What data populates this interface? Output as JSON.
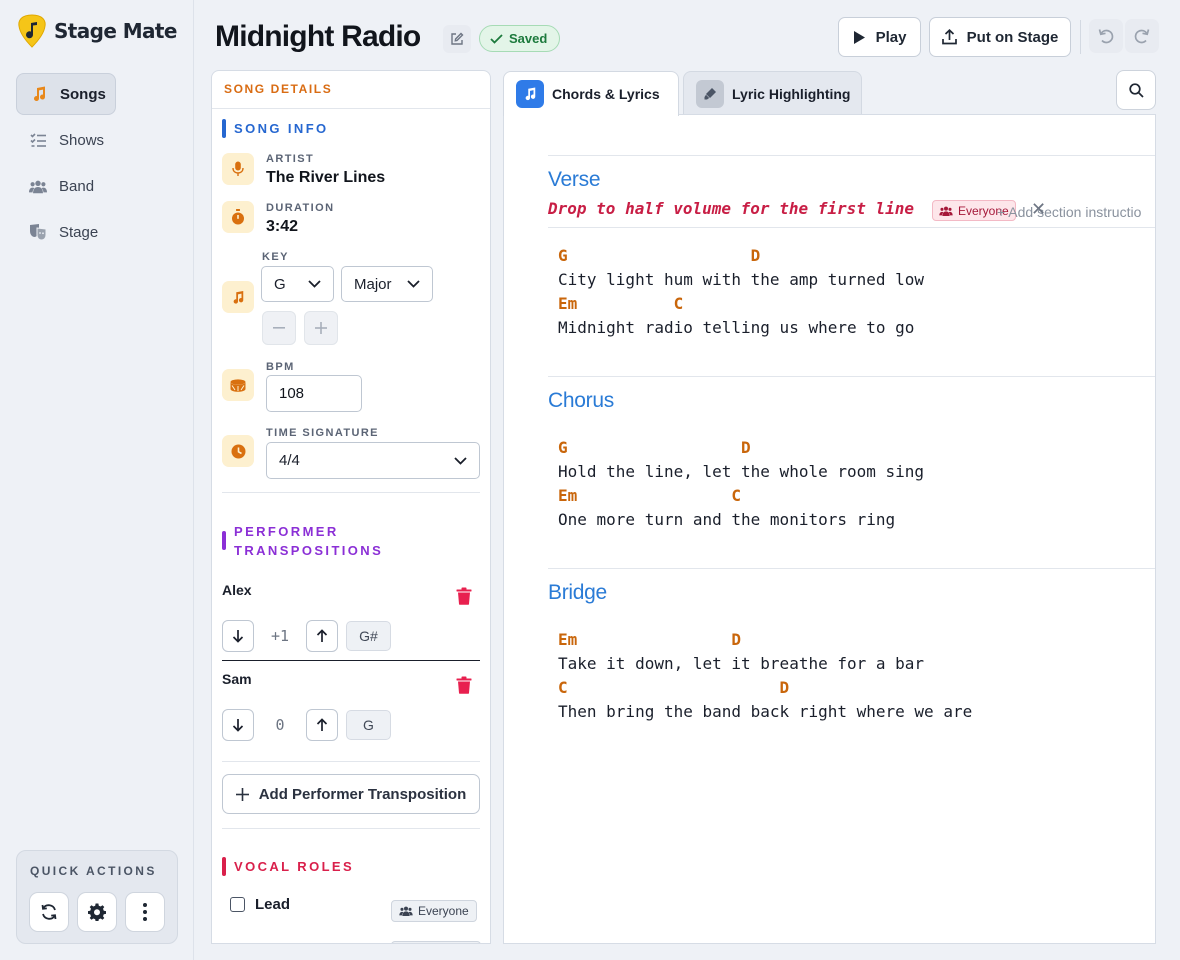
{
  "app": {
    "name": "Stage Mate"
  },
  "sidebar": {
    "items": [
      {
        "label": "Songs",
        "icon": "music-note-icon",
        "active": true
      },
      {
        "label": "Shows",
        "icon": "checklist-icon",
        "active": false
      },
      {
        "label": "Band",
        "icon": "people-icon",
        "active": false
      },
      {
        "label": "Stage",
        "icon": "theater-masks-icon",
        "active": false
      }
    ],
    "quick_actions": {
      "title": "QUICK ACTIONS",
      "buttons": [
        "refresh-icon",
        "gear-icon",
        "more-vertical-icon"
      ]
    }
  },
  "header": {
    "title": "Midnight Radio",
    "status": "Saved",
    "play_label": "Play",
    "stage_label": "Put on Stage"
  },
  "details": {
    "panel_title": "SONG DETAILS",
    "song_info": {
      "title": "SONG INFO",
      "artist_label": "ARTIST",
      "artist": "The River Lines",
      "duration_label": "DURATION",
      "duration": "3:42",
      "key_label": "KEY",
      "key": "G",
      "mode": "Major",
      "bpm_label": "BPM",
      "bpm": "108",
      "time_signature_label": "TIME SIGNATURE",
      "time_signature": "4/4"
    },
    "transpositions": {
      "title": "PERFORMER TRANSPOSITIONS",
      "performers": [
        {
          "name": "Alex",
          "offset": "+1",
          "key": "G#"
        },
        {
          "name": "Sam",
          "offset": "0",
          "key": "G"
        }
      ],
      "add_label": "Add Performer Transposition"
    },
    "vocal_roles": {
      "title": "VOCAL ROLES",
      "roles": [
        {
          "name": "Lead",
          "audience": "Everyone",
          "checked": false
        }
      ]
    }
  },
  "tabs": [
    {
      "label": "Chords & Lyrics",
      "active": true
    },
    {
      "label": "Lyric Highlighting",
      "active": false
    }
  ],
  "sheet": {
    "sections": [
      {
        "name": "Verse",
        "instruction": "Drop to half volume for the first line",
        "instruction_audience": "Everyone",
        "add_instruction_label": "+ Add section instructio",
        "lines": [
          {
            "chords": "G                   D",
            "lyrics": "City light hum with the amp turned low"
          },
          {
            "chords": "Em          C",
            "lyrics": "Midnight radio telling us where to go"
          }
        ]
      },
      {
        "name": "Chorus",
        "lines": [
          {
            "chords": "G                  D",
            "lyrics": "Hold the line, let the whole room sing"
          },
          {
            "chords": "Em                C",
            "lyrics": "One more turn and the monitors ring"
          }
        ]
      },
      {
        "name": "Bridge",
        "lines": [
          {
            "chords": "Em                D",
            "lyrics": "Take it down, let it breathe for a bar"
          },
          {
            "chords": "C                      D",
            "lyrics": "Then bring the band back right where we are"
          }
        ]
      }
    ]
  },
  "colors": {
    "accent_orange": "#d96c13",
    "section_blue": "#2a7bd6",
    "instruction_red": "#c81e45",
    "saved_green": "#1d7a3d",
    "transpositions_purple": "#8b2fd6",
    "vocal_roles_red": "#d9204b"
  }
}
